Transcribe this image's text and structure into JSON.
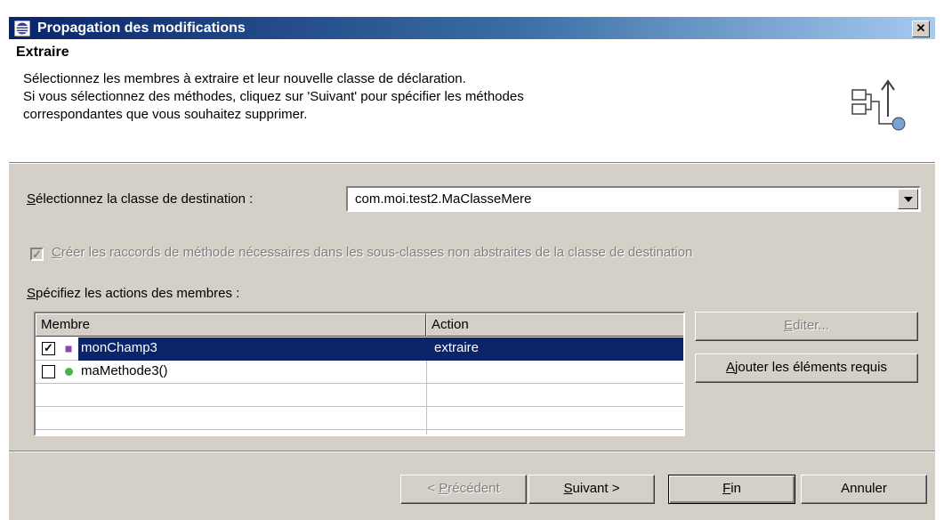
{
  "window": {
    "title": "Propagation des modifications",
    "close_label": "✕"
  },
  "header": {
    "title": "Extraire",
    "description": [
      "Sélectionnez les membres à extraire et leur nouvelle classe de déclaration.",
      "Si vous sélectionnez des méthodes, cliquez sur 'Suivant' pour spécifier les méthodes",
      "correspondantes que vous souhaitez  supprimer."
    ]
  },
  "destination": {
    "label_mnemonic": "S",
    "label_rest": "électionnez la classe de destination :",
    "value": "com.moi.test2.MaClasseMere"
  },
  "stubs_option": {
    "label_mnemonic": "C",
    "label_rest": "réer les raccords de méthode nécessaires dans les sous-classes non abstraites de la classe de destination",
    "checked": true,
    "enabled": false
  },
  "members": {
    "label_mnemonic": "S",
    "label_rest": "pécifiez les actions des membres :",
    "columns": [
      "Membre",
      "Action"
    ],
    "rows": [
      {
        "name": "monChamp3",
        "action": "extraire",
        "checked": true,
        "selected": true,
        "kind": "field"
      },
      {
        "name": "maMethode3()",
        "action": "",
        "checked": false,
        "selected": false,
        "kind": "method"
      }
    ]
  },
  "side_buttons": {
    "edit_mnemonic": "E",
    "edit_rest": "diter...",
    "add_mnemonic": "A",
    "add_rest": "jouter les éléments requis"
  },
  "footer": {
    "back_prefix": "< ",
    "back_mnemonic": "P",
    "back_rest": "récédent",
    "next_mnemonic": "S",
    "next_rest": "uivant >",
    "finish_mnemonic": "F",
    "finish_rest": "in",
    "cancel": "Annuler"
  },
  "colors": {
    "selection": "#0a246a",
    "dialog_bg": "#d4d0c8",
    "method_icon": "#4caf50",
    "field_icon": "#8e44ad"
  }
}
